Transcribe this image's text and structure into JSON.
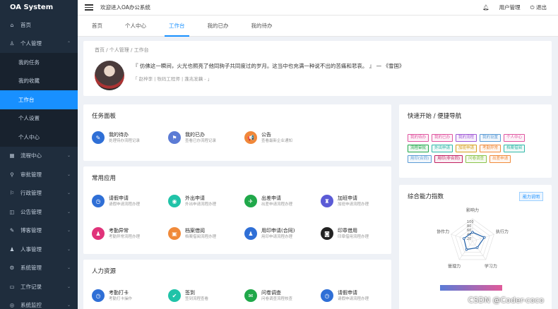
{
  "app": {
    "title": "OA System"
  },
  "sidebar": {
    "items": [
      {
        "label": "首页",
        "icon": "home-icon",
        "level": 0
      },
      {
        "label": "个人管理",
        "icon": "user-icon",
        "level": 0,
        "arrow": "⌃"
      },
      {
        "label": "我的任务",
        "level": 1
      },
      {
        "label": "我的收藏",
        "level": 1
      },
      {
        "label": "工作台",
        "level": 1,
        "active": true
      },
      {
        "label": "个人设置",
        "level": 1
      },
      {
        "label": "个人中心",
        "level": 1
      },
      {
        "label": "流程中心",
        "icon": "flow-icon",
        "level": 0,
        "arrow": "⌄"
      },
      {
        "label": "审批管理",
        "icon": "approve-icon",
        "level": 0,
        "arrow": "⌄"
      },
      {
        "label": "行政管理",
        "icon": "admin-icon",
        "level": 0,
        "arrow": "⌄"
      },
      {
        "label": "公告管理",
        "icon": "notice-icon",
        "level": 0,
        "arrow": "⌄"
      },
      {
        "label": "博客管理",
        "icon": "blog-icon",
        "level": 0,
        "arrow": "⌄"
      },
      {
        "label": "人事管理",
        "icon": "hr-icon",
        "level": 0,
        "arrow": "⌄"
      },
      {
        "label": "系统管理",
        "icon": "system-icon",
        "level": 0,
        "arrow": "⌄"
      },
      {
        "label": "工作记录",
        "icon": "record-icon",
        "level": 0,
        "arrow": "⌄"
      },
      {
        "label": "系统监控",
        "icon": "monitor-icon",
        "level": 0,
        "arrow": "⌄"
      }
    ]
  },
  "header": {
    "welcome": "欢迎进入OA办公系统",
    "user_mgmt": "用户管理",
    "logout": "退出"
  },
  "tabs": [
    {
      "label": "首页"
    },
    {
      "label": "个人中心"
    },
    {
      "label": "工作台",
      "active": true
    },
    {
      "label": "我的已办"
    },
    {
      "label": "我的待办"
    }
  ],
  "profile": {
    "breadcrumb": "首页  /  个人管理  /  工作台",
    "quote": "『 仿佛这一瞬间，火光也照亮了他同驹子共同度过的岁月。这当中也充满一种说不出的苦痛和悲哀。 』 — 《雪国》",
    "signature": "「 赵梓李 | 牧码工程师 | 蓬兆发藕 - 」"
  },
  "task_panel": {
    "title": "任务面板",
    "items": [
      {
        "title": "我的待办",
        "sub": "处理待办流程记录",
        "icon": "edit-icon",
        "color": "#2f6fd6",
        "glyph": "✎"
      },
      {
        "title": "我的已办",
        "sub": "查看已办流程记录",
        "icon": "flag-icon",
        "color": "#5b7bd5",
        "glyph": "⚑"
      },
      {
        "title": "公告",
        "sub": "查看最新企业通知",
        "icon": "megaphone-icon",
        "color": "#f0883a",
        "glyph": "📢"
      }
    ]
  },
  "apps": {
    "title": "常用应用",
    "items": [
      {
        "title": "请假申请",
        "sub": "请假申请流程办理",
        "icon": "clock-icon",
        "color": "#2f6fd6",
        "glyph": "◷"
      },
      {
        "title": "外出申请",
        "sub": "外出申请流程办理",
        "icon": "location-icon",
        "color": "#20c3a8",
        "glyph": "◉"
      },
      {
        "title": "出差申请",
        "sub": "出差申请流程办理",
        "icon": "plane-icon",
        "color": "#20a84a",
        "glyph": "✈"
      },
      {
        "title": "加班申请",
        "sub": "加班申请流程办理",
        "icon": "lamp-icon",
        "color": "#5b5bd6",
        "glyph": "♜"
      },
      {
        "title": "考勤异常",
        "sub": "考勤异常流程办理",
        "icon": "person-icon",
        "color": "#e0337a",
        "glyph": "♟"
      },
      {
        "title": "档案借阅",
        "sub": "档案借阅流程办理",
        "icon": "archive-icon",
        "color": "#f08a3a",
        "glyph": "▣"
      },
      {
        "title": "用印申请(合同)",
        "sub": "用印申请流程办理",
        "icon": "seal-icon",
        "color": "#2f6fd6",
        "glyph": "♟"
      },
      {
        "title": "印章借用",
        "sub": "印章借用流程办理",
        "icon": "stamp-icon",
        "color": "#222",
        "glyph": "◙"
      }
    ]
  },
  "hr": {
    "title": "人力资源",
    "items": [
      {
        "title": "考勤打卡",
        "sub": "考勤打卡操作",
        "icon": "checkin-icon",
        "color": "#2f6fd6",
        "glyph": "◷"
      },
      {
        "title": "签到",
        "sub": "签到流程查看",
        "icon": "signin-icon",
        "color": "#20c3a8",
        "glyph": "✔"
      },
      {
        "title": "问卷调查",
        "sub": "问卷调查流程核查",
        "icon": "survey-icon",
        "color": "#20a84a",
        "glyph": "✉"
      },
      {
        "title": "请假申请",
        "sub": "请假申请流程办理",
        "icon": "leave-icon",
        "color": "#2f6fd6",
        "glyph": "◷"
      }
    ]
  },
  "quick_nav": {
    "title": "快速开始 / 便捷导航",
    "tags": [
      {
        "label": "我的待办",
        "color": "#e056a0"
      },
      {
        "label": "我的已办",
        "color": "#e056a0"
      },
      {
        "label": "我的流程",
        "color": "#a05ad6"
      },
      {
        "label": "我的设置",
        "color": "#5b9bd5"
      },
      {
        "label": "个人中心",
        "color": "#e056a0"
      },
      {
        "label": "流程审批",
        "color": "#20a84a"
      },
      {
        "label": "外出申请",
        "color": "#2fb8a8"
      },
      {
        "label": "加班申请",
        "color": "#d6a020"
      },
      {
        "label": "考勤异常",
        "color": "#f08a3a"
      },
      {
        "label": "档案借阅",
        "color": "#2fb8a8"
      },
      {
        "label": "用印(合同)",
        "color": "#5b9bd5"
      },
      {
        "label": "用印(非合同)",
        "color": "#c02060"
      },
      {
        "label": "问卷调查",
        "color": "#8bc34a"
      },
      {
        "label": "出差申请",
        "color": "#f08a3a"
      }
    ]
  },
  "ability": {
    "title": "综合能力指数",
    "button": "能力说明",
    "chart_data": {
      "type": "radar",
      "axes": [
        "影响力",
        "执行力",
        "学习力",
        "管理力",
        "协作力"
      ],
      "values": [
        40,
        55,
        35,
        45,
        40
      ],
      "ticks": [
        "100",
        "80",
        "60",
        "40",
        "20"
      ]
    }
  },
  "watermark": "CSDN @Coder-coco"
}
